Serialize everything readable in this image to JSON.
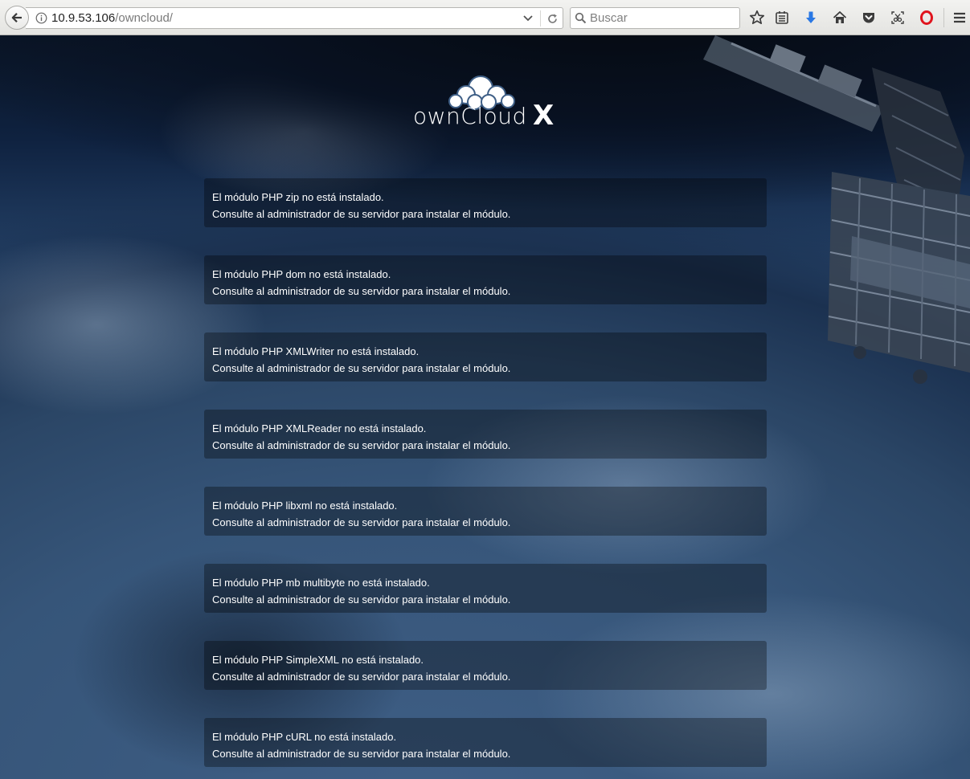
{
  "browser": {
    "url_host": "10.9.53.106",
    "url_path": "/owncloud/",
    "search_placeholder": "Buscar",
    "icons": [
      "back-arrow-icon",
      "info-icon",
      "dropdown-arrow-icon",
      "reload-icon",
      "search-icon",
      "bookmark-star-icon",
      "reader-list-icon",
      "download-icon",
      "home-icon",
      "pocket-icon",
      "screenshot-icon",
      "opera-icon",
      "menu-icon"
    ],
    "colors": {
      "download": "#2a78e4",
      "opera": "#e0141d"
    }
  },
  "logo": {
    "text": "ownCloud",
    "suffix": "X"
  },
  "errors": [
    {
      "title": "El módulo PHP zip no está instalado.",
      "hint": "Consulte al administrador de su servidor para instalar el módulo."
    },
    {
      "title": "El módulo PHP dom no está instalado.",
      "hint": "Consulte al administrador de su servidor para instalar el módulo."
    },
    {
      "title": "El módulo PHP XMLWriter no está instalado.",
      "hint": "Consulte al administrador de su servidor para instalar el módulo."
    },
    {
      "title": "El módulo PHP XMLReader no está instalado.",
      "hint": "Consulte al administrador de su servidor para instalar el módulo."
    },
    {
      "title": "El módulo PHP libxml no está instalado.",
      "hint": "Consulte al administrador de su servidor para instalar el módulo."
    },
    {
      "title": "El módulo PHP mb multibyte no está instalado.",
      "hint": "Consulte al administrador de su servidor para instalar el módulo."
    },
    {
      "title": "El módulo PHP SimpleXML no está instalado.",
      "hint": "Consulte al administrador de su servidor para instalar el módulo."
    },
    {
      "title": "El módulo PHP cURL no está instalado.",
      "hint": "Consulte al administrador de su servidor para instalar el módulo."
    }
  ]
}
